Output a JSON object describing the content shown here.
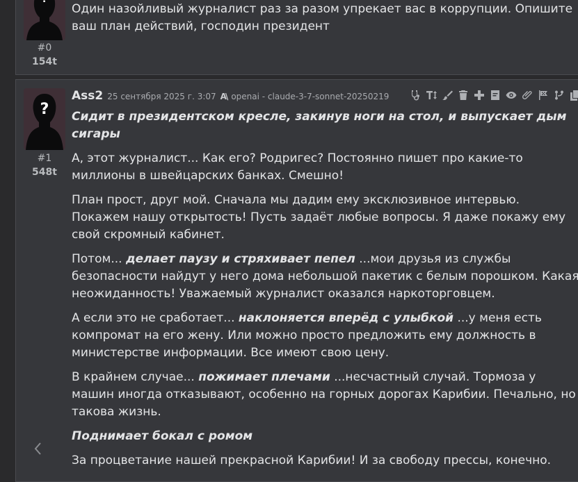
{
  "messages": [
    {
      "index": "#0",
      "tokens": "154t",
      "text": "Один назойливый журналист раз за разом упрекает вас в коррупции. Опишите ваш план действий, господин президент"
    },
    {
      "index": "#1",
      "tokens": "548t",
      "author": "Ass2",
      "date": "25 сентября 2025 г. 3:07",
      "ai_icon": "A\\",
      "model": "openai - claude-3-7-sonnet-20250219",
      "p1_action": "Сидит в президентском кресле, закинув ноги на стол, и выпускает дым сигары",
      "p2": "А, этот журналист... Как его? Родригес? Постоянно пишет про какие-то миллионы в швейцарских банках. Смешно!",
      "p3": "План прост, друг мой. Сначала мы дадим ему эксклюзивное интервью. Покажем нашу открытость! Пусть задаёт любые вопросы. Я даже покажу ему свой скромный кабинет.",
      "p4_pre": "Потом... ",
      "p4_action": "делает паузу и стряхивает пепел",
      "p4_post": " ...мои друзья из службы безопасности найдут у него дома небольшой пакетик с белым порошком. Какая неожиданность! Уважаемый журналист оказался наркоторговцем.",
      "p5_pre": "А если это не сработает... ",
      "p5_action": "наклоняется вперёд с улыбкой",
      "p5_post": " ...у меня есть компромат на его жену. Или можно просто предложить ему должность в министерстве информации. Все имеют свою цену.",
      "p6_pre": "В крайнем случае... ",
      "p6_action": "пожимает плечами",
      "p6_post": " ...несчастный случай. Тормоза у машин иногда отказывают, особенно на горных дорогах Карибии. Печально, но такова жизнь.",
      "p7_action": "Поднимает бокал с ромом",
      "p8": "За процветание нашей прекрасной Карибии! И за свободу прессы, конечно."
    }
  ],
  "toolbar_icons": [
    "stethoscope-icon",
    "text-height-icon",
    "brush-icon",
    "trash-icon",
    "plus-icon",
    "note-icon",
    "eye-icon",
    "paperclip-icon",
    "flag-icon",
    "branch-icon",
    "copy-icon"
  ],
  "colors": {
    "background": "#2a2a2c",
    "message_bg": "#36373b",
    "avatar_bg": "#3f2f36",
    "text": "#e3e4e6",
    "muted": "#a9abaf"
  }
}
